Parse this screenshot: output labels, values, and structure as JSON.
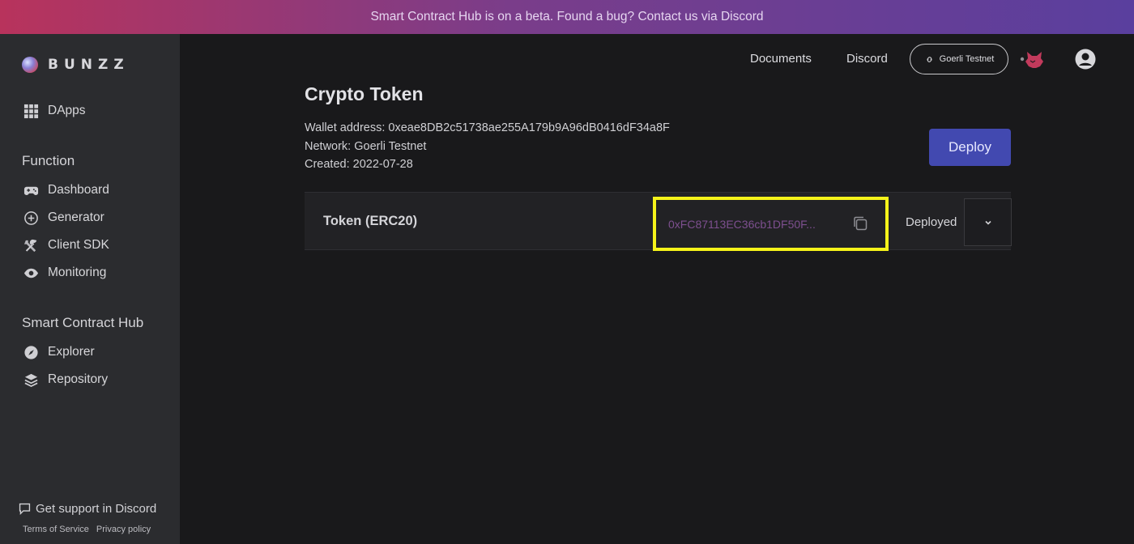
{
  "banner": {
    "text": "Smart Contract Hub is on a beta. Found a bug? Contact us via Discord"
  },
  "brand": {
    "name": "BUNZZ"
  },
  "sidebar": {
    "top_items": [
      {
        "label": "DApps",
        "icon": "grid-icon"
      }
    ],
    "function_title": "Function",
    "function_items": [
      {
        "label": "Dashboard",
        "icon": "gamepad-icon"
      },
      {
        "label": "Generator",
        "icon": "plus-circle-icon"
      },
      {
        "label": "Client SDK",
        "icon": "tools-icon"
      },
      {
        "label": "Monitoring",
        "icon": "eye-icon"
      }
    ],
    "hub_title": "Smart Contract Hub",
    "hub_items": [
      {
        "label": "Explorer",
        "icon": "compass-icon"
      },
      {
        "label": "Repository",
        "icon": "layers-icon"
      }
    ],
    "support_label": "Get support in Discord",
    "terms_label": "Terms of Service",
    "privacy_label": "Privacy policy"
  },
  "header": {
    "documents_label": "Documents",
    "discord_label": "Discord",
    "network_label": "Goerli Testnet"
  },
  "page": {
    "title": "Crypto Token",
    "wallet_line": "Wallet address: 0xeae8DB2c51738ae255A179b9A96dB0416dF34a8F",
    "network_line": "Network: Goerli Testnet",
    "created_line": "Created: 2022-07-28",
    "deploy_label": "Deploy"
  },
  "contract": {
    "name": "Token (ERC20)",
    "address": "0xFC87113EC36cb1DF50F...",
    "status": "Deployed"
  },
  "colors": {
    "accent": "#4249b0",
    "highlight": "#f6f31a",
    "address_text": "#7d4f8f"
  }
}
